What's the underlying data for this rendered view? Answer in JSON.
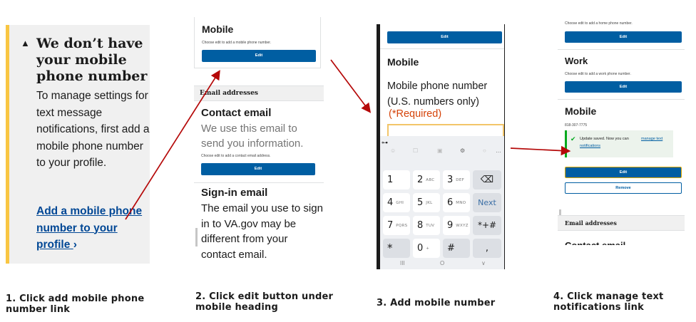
{
  "steps": [
    {
      "caption": "1. Click add mobile phone number link"
    },
    {
      "caption": "2. Click edit button under mobile heading"
    },
    {
      "caption": "3. Add mobile number"
    },
    {
      "caption": "4. Click manage text notifications link"
    }
  ],
  "panel1": {
    "heading": "We don’t have your mobile phone number",
    "body": "To manage settings for text message notifications, first add a mobile phone number to your profile.",
    "link": "Add a mobile phone number to your profile",
    "link_chevron": "›",
    "warn_glyph": "▲"
  },
  "panel2": {
    "mobile_heading": "Mobile",
    "mobile_hint": "Choose edit to add a mobile phone number.",
    "edit_label": "Edit",
    "email_section": "Email addresses",
    "contact_heading": "Contact email",
    "contact_desc": "We use this email to send you information.",
    "contact_hint": "Choose edit to add a contact email address.",
    "edit2_label": "Edit",
    "signin_heading": "Sign-in email",
    "signin_desc": "The email you use to sign in to VA.gov may be different from your contact email."
  },
  "panel3": {
    "top_edit_label": "Edit",
    "mobile_heading": "Mobile",
    "field_label": "Mobile phone number (U.S. numbers only)",
    "required": "(*Required)",
    "keys": [
      {
        "main": "1",
        "sub": ""
      },
      {
        "main": "2",
        "sub": "ABC"
      },
      {
        "main": "3",
        "sub": "DEF"
      },
      {
        "main": "⌫",
        "sub": ""
      },
      {
        "main": "4",
        "sub": "GHI"
      },
      {
        "main": "5",
        "sub": "JKL"
      },
      {
        "main": "6",
        "sub": "MNO"
      },
      {
        "main": "Next",
        "sub": ""
      },
      {
        "main": "7",
        "sub": "PQRS"
      },
      {
        "main": "8",
        "sub": "TUV"
      },
      {
        "main": "9",
        "sub": "WXYZ"
      },
      {
        "main": "*+#",
        "sub": ""
      },
      {
        "main": "*",
        "sub": ""
      },
      {
        "main": "0",
        "sub": "+"
      },
      {
        "main": "#",
        "sub": ""
      },
      {
        "main": ",",
        "sub": ""
      }
    ],
    "nav": [
      "III",
      "O",
      "∨"
    ]
  },
  "panel4": {
    "home_hint": "Choose edit to add a home phone number.",
    "edit_label": "Edit",
    "work_heading": "Work",
    "work_hint": "Choose edit to add a work phone number.",
    "mobile_heading": "Mobile",
    "mobile_number": "818-307-7775",
    "success_text": "Update saved. Now you can",
    "success_link_1": "manage text",
    "success_link_2": "notifications",
    "remove_label": "Remove",
    "email_section": "Email addresses",
    "contact_heading": "Contact email"
  },
  "colors": {
    "primary": "#005ea2",
    "warning_border": "#f9c642",
    "arrow": "#b50909",
    "required": "#d54309",
    "success": "#00a91c"
  }
}
